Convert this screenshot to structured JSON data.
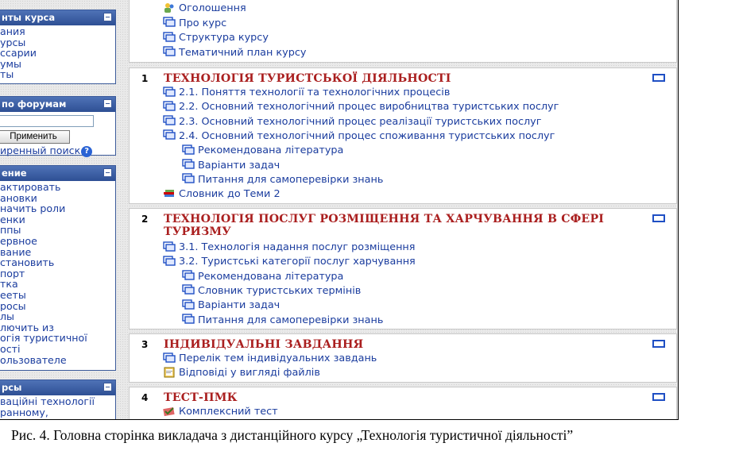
{
  "sidebar": {
    "blocks": [
      {
        "title": "нты курса",
        "items": [
          "ания",
          "урсы",
          "ссарии",
          "умы",
          "ты"
        ]
      },
      {
        "title": "по форумам",
        "button": "Применить",
        "advanced": "иренный поиск",
        "help_icon": "help-icon"
      },
      {
        "title": "ение",
        "items": [
          "актировать",
          "ановки",
          "начить роли",
          "енки",
          "ппы",
          "ервное",
          "вание",
          "становить",
          "порт",
          "тка",
          "ееты",
          "росы",
          "лы",
          "лючить из",
          "огія туристичної",
          "ості",
          "ользователе"
        ]
      },
      {
        "title": "рсы",
        "items": [
          "ваційні технології",
          "ранному,"
        ]
      }
    ]
  },
  "topics": {
    "intro": [
      {
        "label": "Оголошення",
        "icon": "forum-icon"
      },
      {
        "label": "Про курс",
        "icon": "resource-icon"
      },
      {
        "label": "Структура курсу",
        "icon": "resource-icon"
      },
      {
        "label": "Тематичний план курсу",
        "icon": "resource-icon"
      }
    ],
    "sections": [
      {
        "num": "1",
        "title": "ТЕХНОЛОГІЯ ТУРИСТСЬКОЇ ДІЯЛЬНОСТІ",
        "items": [
          {
            "label": "2.1. Поняття технології та технологічних процесів",
            "icon": "resource-icon",
            "indent": false
          },
          {
            "label": "2.2. Основний технологічний процес виробництва туристських послуг",
            "icon": "resource-icon",
            "indent": false
          },
          {
            "label": "2.3. Основний технологічний процес реалізації туристських послуг",
            "icon": "resource-icon",
            "indent": false
          },
          {
            "label": "2.4. Основний технологічний процес споживання туристських послуг",
            "icon": "resource-icon",
            "indent": false
          },
          {
            "label": "Рекомендована література",
            "icon": "resource-icon",
            "indent": true
          },
          {
            "label": "Варіанти задач",
            "icon": "resource-icon",
            "indent": true
          },
          {
            "label": "Питання для самоперевірки знань",
            "icon": "resource-icon",
            "indent": true
          },
          {
            "label": "Словник до Теми 2",
            "icon": "glossary-icon",
            "indent": false
          }
        ]
      },
      {
        "num": "2",
        "title": "ТЕХНОЛОГІЯ ПОСЛУГ РОЗМІЩЕННЯ ТА ХАРЧУВАННЯ В СФЕРІ ТУРИЗМУ",
        "items": [
          {
            "label": "3.1. Технологія надання послуг розміщення",
            "icon": "resource-icon",
            "indent": false
          },
          {
            "label": "3.2. Туристські категорії послуг харчування",
            "icon": "resource-icon",
            "indent": false
          },
          {
            "label": "Рекомендована література",
            "icon": "resource-icon",
            "indent": true
          },
          {
            "label": "Словник туристських термінів",
            "icon": "resource-icon",
            "indent": true
          },
          {
            "label": "Варіанти задач",
            "icon": "resource-icon",
            "indent": true
          },
          {
            "label": "Питання для самоперевірки знань",
            "icon": "resource-icon",
            "indent": true
          }
        ]
      },
      {
        "num": "3",
        "title": "ІНДИВІДУАЛЬНІ ЗАВДАННЯ",
        "items": [
          {
            "label": "Перелік тем індивідуальних завдань",
            "icon": "resource-icon",
            "indent": false
          },
          {
            "label": "Відповіді у вигляді файлів",
            "icon": "assignment-icon",
            "indent": false
          }
        ]
      },
      {
        "num": "4",
        "title": "ТЕСТ-ПМК",
        "items": [
          {
            "label": "Комплексний тест",
            "icon": "quiz-icon",
            "indent": false
          }
        ]
      }
    ]
  },
  "caption": "Рис. 4. Головна сторінка викладача з дистанційного курсу „Технологія туристичної діяльності”",
  "colors": {
    "block_header": "#3a5ea6",
    "link": "#1a3c9e",
    "section_title": "#aa1f1f"
  }
}
